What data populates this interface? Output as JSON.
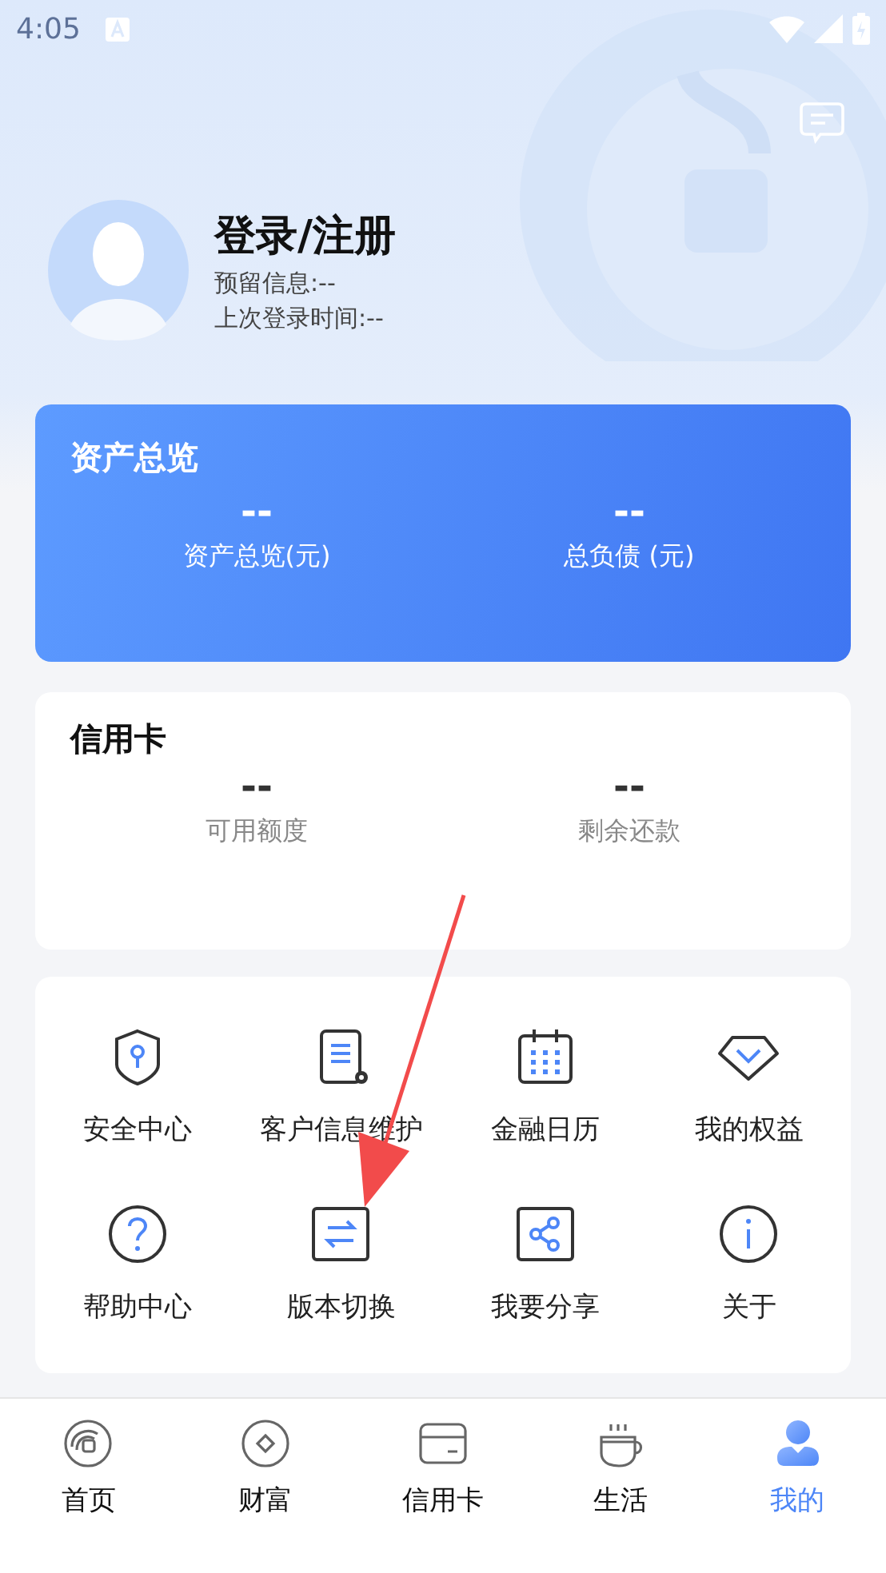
{
  "status_bar": {
    "time": "4:05"
  },
  "profile": {
    "title": "登录/注册",
    "reserved_info": "预留信息:--",
    "last_login": "上次登录时间:--"
  },
  "assets": {
    "title": "资产总览",
    "items": [
      {
        "value": "--",
        "label": "资产总览(元)"
      },
      {
        "value": "--",
        "label": "总负债 (元)"
      }
    ]
  },
  "credit": {
    "title": "信用卡",
    "items": [
      {
        "value": "--",
        "label": "可用额度"
      },
      {
        "value": "--",
        "label": "剩余还款"
      }
    ]
  },
  "menu": {
    "items": [
      {
        "kind": "shield",
        "label": "安全中心"
      },
      {
        "kind": "document",
        "label": "客户信息维护"
      },
      {
        "kind": "calendar",
        "label": "金融日历"
      },
      {
        "kind": "gem",
        "label": "我的权益"
      },
      {
        "kind": "help",
        "label": "帮助中心"
      },
      {
        "kind": "switch",
        "label": "版本切换"
      },
      {
        "kind": "share",
        "label": "我要分享"
      },
      {
        "kind": "info",
        "label": "关于"
      }
    ]
  },
  "tabs": [
    {
      "kind": "home",
      "label": "首页",
      "selected": false
    },
    {
      "kind": "wealth",
      "label": "财富",
      "selected": false
    },
    {
      "kind": "card",
      "label": "信用卡",
      "selected": false
    },
    {
      "kind": "life",
      "label": "生活",
      "selected": false
    },
    {
      "kind": "me",
      "label": "我的",
      "selected": true
    }
  ]
}
